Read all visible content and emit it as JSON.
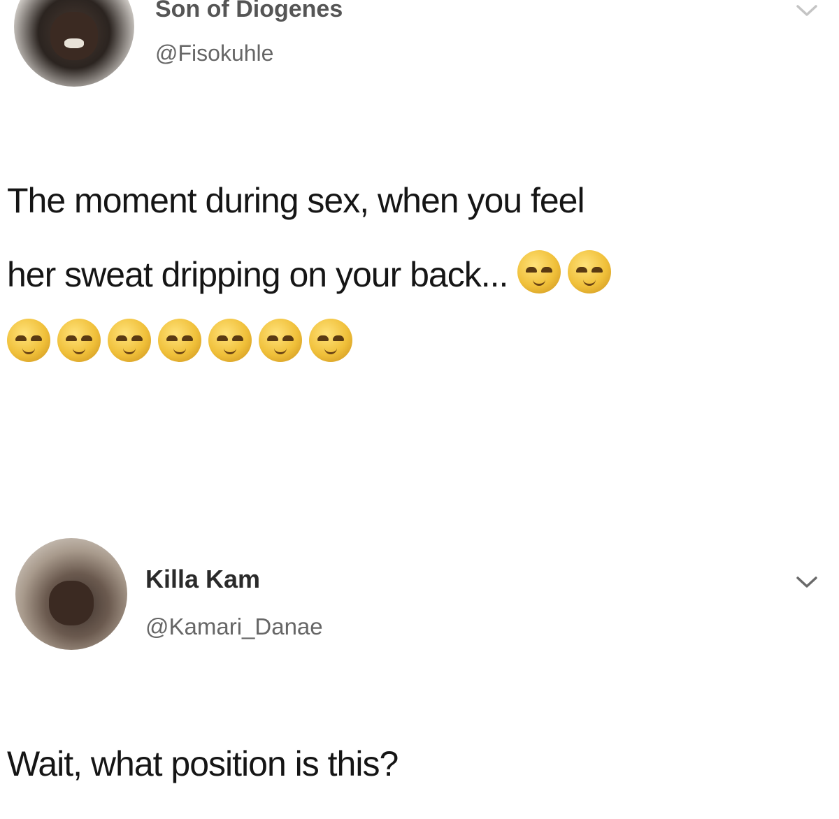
{
  "tweets": [
    {
      "display_name": "Son of Diogenes",
      "handle": "@Fisokuhle",
      "text_lines": [
        "The moment during sex, when you feel",
        "her sweat dripping on your back..."
      ],
      "emoji_icon": "relieved-face-icon",
      "emoji_inline_count": 2,
      "emoji_row_count": 7
    },
    {
      "display_name": "Killa Kam",
      "handle": "@Kamari_Danae",
      "text_lines": [
        "Wait, what position is this?"
      ]
    }
  ],
  "colors": {
    "background": "#ffffff",
    "text": "#151515",
    "handle": "#666666",
    "emoji": "#f0c03a"
  }
}
